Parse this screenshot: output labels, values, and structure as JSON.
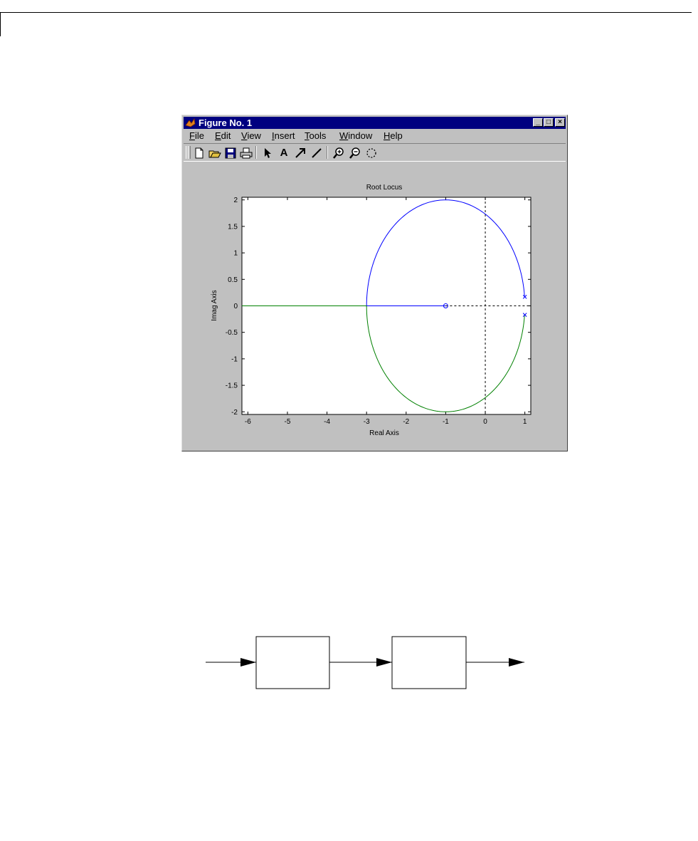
{
  "window": {
    "title": "Figure No. 1",
    "controls": {
      "minimize": "_",
      "maximize": "□",
      "close": "×"
    }
  },
  "menu": {
    "items": [
      {
        "label": "File",
        "key": "F",
        "rest": "ile"
      },
      {
        "label": "Edit",
        "key": "E",
        "rest": "dit"
      },
      {
        "label": "View",
        "key": "V",
        "rest": "iew"
      },
      {
        "label": "Insert",
        "key": "I",
        "rest": "nsert"
      },
      {
        "label": "Tools",
        "key": "T",
        "rest": "ools"
      },
      {
        "label": "Window",
        "key": "W",
        "rest": "indow"
      },
      {
        "label": "Help",
        "key": "H",
        "rest": "elp"
      }
    ]
  },
  "toolbar": {
    "icons": [
      "new-file-icon",
      "open-file-icon",
      "save-icon",
      "print-icon",
      "pointer-icon",
      "text-icon",
      "arrow-icon",
      "line-icon",
      "zoom-in-icon",
      "zoom-out-icon",
      "rotate-icon"
    ],
    "text_tool": "A"
  },
  "chart_data": {
    "type": "line",
    "title": "Root Locus",
    "xlabel": "Real Axis",
    "ylabel": "Imag Axis",
    "xlim": [
      -6.15,
      1.15
    ],
    "ylim": [
      -2.05,
      2.05
    ],
    "xticks": [
      -6,
      -5,
      -4,
      -3,
      -2,
      -1,
      0,
      1
    ],
    "yticks": [
      2,
      1.5,
      1,
      0.5,
      0,
      -0.5,
      -1,
      -1.5,
      -2
    ],
    "xtick_labels": [
      "-6",
      "-5",
      "-4",
      "-3",
      "-2",
      "-1",
      "0",
      "1"
    ],
    "ytick_labels": [
      "2",
      "1.5",
      "1",
      "0.5",
      "0",
      "-0.5",
      "-1",
      "-1.5",
      "-2"
    ],
    "poles": [
      [
        1,
        0.17
      ],
      [
        1,
        -0.17
      ]
    ],
    "zeros": [
      [
        -1,
        0
      ]
    ],
    "series": [
      {
        "color": "#0000ff",
        "branch": "upper",
        "circle_center": [
          -1,
          0
        ],
        "circle_radius": 2.0,
        "real_segment": [
          -3,
          -1
        ]
      },
      {
        "color": "#008000",
        "branch": "lower",
        "circle_center": [
          -1,
          0
        ],
        "circle_radius": 2.0,
        "real_segment": [
          -6.15,
          -3
        ]
      }
    ],
    "grid": false
  },
  "diagram": {
    "blocks": [
      {
        "label": ""
      },
      {
        "label": ""
      }
    ]
  }
}
